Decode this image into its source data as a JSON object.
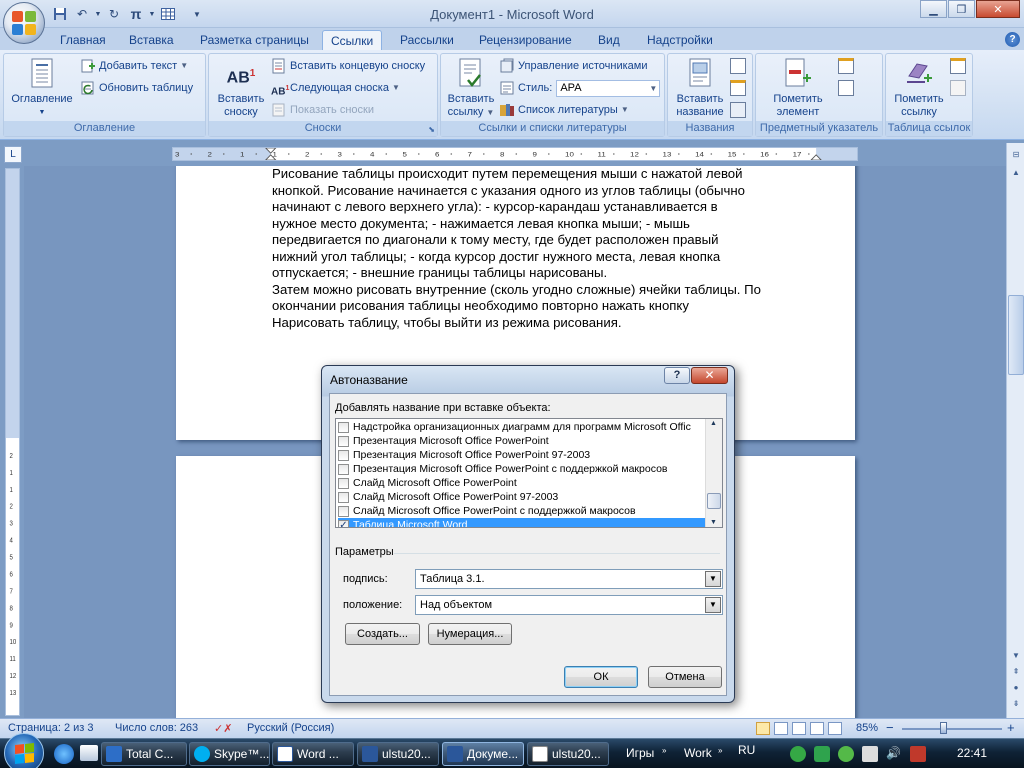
{
  "window": {
    "title": "Документ1 - Microsoft Word",
    "minimize_icon": "minimize-icon",
    "maximize_icon": "restore-icon",
    "close_icon": "close-icon"
  },
  "quick_access": [
    "save-icon",
    "undo-icon",
    "redo-icon",
    "pi-equation-icon",
    "table-icon",
    "customize-dropdown-icon"
  ],
  "tabs": [
    {
      "label": "Главная",
      "active": false
    },
    {
      "label": "Вставка",
      "active": false
    },
    {
      "label": "Разметка страницы",
      "active": false
    },
    {
      "label": "Ссылки",
      "active": true
    },
    {
      "label": "Рассылки",
      "active": false
    },
    {
      "label": "Рецензирование",
      "active": false
    },
    {
      "label": "Вид",
      "active": false
    },
    {
      "label": "Надстройки",
      "active": false
    }
  ],
  "ribbon": {
    "toc": {
      "group": "Оглавление",
      "toc_button": "Оглавление",
      "add_text": "Добавить текст",
      "update_table": "Обновить таблицу"
    },
    "footnotes": {
      "group": "Сноски",
      "insert_footnote": "Вставить сноску",
      "insert_footnote_lines": [
        "Вставить",
        "сноску"
      ],
      "insert_endnote": "Вставить концевую сноску",
      "next_footnote": "Следующая сноска",
      "show_notes": "Показать сноски"
    },
    "citations": {
      "group": "Ссылки и списки литературы",
      "insert_citation_lines": [
        "Вставить",
        "ссылку"
      ],
      "manage_sources": "Управление источниками",
      "style_label": "Стиль:",
      "style_value": "APA",
      "bibliography": "Список литературы"
    },
    "captions": {
      "group": "Названия",
      "insert_caption_lines": [
        "Вставить",
        "название"
      ]
    },
    "index": {
      "group": "Предметный указатель",
      "mark_entry_lines": [
        "Пометить",
        "элемент"
      ]
    },
    "toa": {
      "group": "Таблица ссылок",
      "mark_citation_lines": [
        "Пометить",
        "ссылку"
      ]
    }
  },
  "ruler": {
    "ticks": [
      "3",
      "2",
      "1",
      "1",
      "2",
      "3",
      "4",
      "5",
      "6",
      "7",
      "8",
      "9",
      "10",
      "11",
      "12",
      "13",
      "14",
      "15",
      "16",
      "17"
    ],
    "vticks": [
      "2",
      "1",
      "1",
      "2",
      "3",
      "4",
      "5",
      "6",
      "7",
      "8",
      "9",
      "10",
      "11",
      "12",
      "13"
    ]
  },
  "document": {
    "lines": [
      "Рисование таблицы происходит путем перемещения мыши с нажатой левой",
      "кнопкой. Рисование начинается с указания одного из углов таблицы (обычно",
      "начинают с левого верхнего угла): - курсор-карандаш устанавливается в",
      "нужное место документа; - нажимается левая кнопка мыши; - мышь",
      "передвигается по диагонали к тому месту, где будет расположен правый",
      "нижний угол таблицы; - когда курсор достиг нужного места, левая кнопка",
      "отпускается; - внешние границы таблицы нарисованы.",
      "Затем можно рисовать внутренние (сколь угодно сложные) ячейки таблицы. По",
      "окончании рисования таблицы необходимо повторно нажать кнопку",
      "Нарисовать таблицу, чтобы выйти из режима рисования."
    ]
  },
  "dialog": {
    "title": "Автоназвание",
    "help_label": "?",
    "close_label": "✕",
    "add_label": "Добавлять название при вставке объекта:",
    "items": [
      {
        "label": "Надстройка организационных диаграмм для программ Microsoft Offic",
        "checked": false,
        "selected": false
      },
      {
        "label": "Презентация Microsoft Office PowerPoint",
        "checked": false,
        "selected": false
      },
      {
        "label": "Презентация Microsoft Office PowerPoint 97-2003",
        "checked": false,
        "selected": false
      },
      {
        "label": "Презентация Microsoft Office PowerPoint с поддержкой макросов",
        "checked": false,
        "selected": false
      },
      {
        "label": "Слайд Microsoft Office PowerPoint",
        "checked": false,
        "selected": false
      },
      {
        "label": "Слайд Microsoft Office PowerPoint 97-2003",
        "checked": false,
        "selected": false
      },
      {
        "label": "Слайд Microsoft Office PowerPoint с поддержкой макросов",
        "checked": false,
        "selected": false
      },
      {
        "label": "Таблица Microsoft Word",
        "checked": true,
        "selected": true
      }
    ],
    "params_label": "Параметры",
    "caption_label": "подпись:",
    "caption_value": "Таблица 3.1.",
    "position_label": "положение:",
    "position_value": "Над объектом",
    "create_button": "Создать...",
    "numbering_button": "Нумерация...",
    "ok_button": "ОК",
    "cancel_button": "Отмена"
  },
  "status": {
    "page": "Страница: 2 из 3",
    "words": "Число слов: 263",
    "language": "Русский (Россия)",
    "zoom": "85%",
    "zoom_minus": "−",
    "zoom_plus": "+",
    "zoom_level": 0.85
  },
  "taskbar": {
    "buttons": [
      {
        "label": "Total C...",
        "icon": "total-commander-icon",
        "active": false
      },
      {
        "label": "Skype™...",
        "icon": "skype-icon",
        "active": false
      },
      {
        "label": "Word ...",
        "icon": "word-icon",
        "active": false
      },
      {
        "label": "ulstu20...",
        "icon": "word-doc-icon",
        "active": false
      },
      {
        "label": "Докуме...",
        "icon": "word-doc-icon",
        "active": true
      },
      {
        "label": "ulstu20...",
        "icon": "image-editor-icon",
        "active": false
      }
    ],
    "games": "Игры",
    "work": "Work",
    "lang": "RU",
    "time": "22:41"
  },
  "colors": {
    "accent": "#15428b",
    "selection": "#3399ff",
    "close_red": "#c84b31"
  }
}
